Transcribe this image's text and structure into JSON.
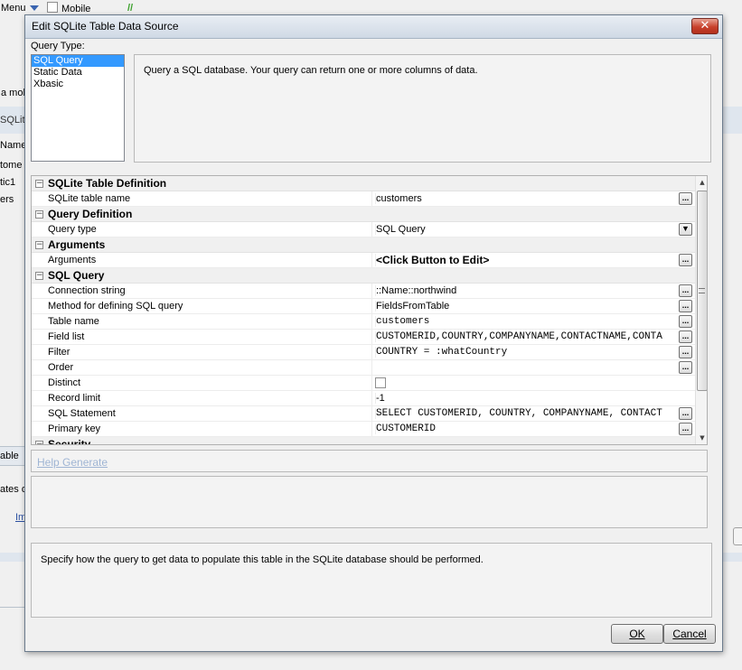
{
  "background_app": {
    "menu_label": "Menu",
    "mobile_label": "Mobile",
    "left_fragments": [
      "a mob",
      "SQLite",
      "Name",
      "tome",
      "tic1",
      "ers",
      "able",
      "ates d",
      "Im"
    ]
  },
  "dialog": {
    "title": "Edit SQLite Table Data Source",
    "close_symbol": "✕",
    "query_type": {
      "label": "Query Type:",
      "options": [
        "SQL Query",
        "Static Data",
        "Xbasic"
      ],
      "selected": "SQL Query"
    },
    "description": "Query a SQL database. Your query can return one or more columns of data.",
    "grid": {
      "rows": [
        {
          "kind": "category",
          "title": "SQLite Table Definition",
          "toggle": "−"
        },
        {
          "kind": "prop",
          "name": "SQLite table name",
          "value": "customers",
          "button": "..."
        },
        {
          "kind": "category",
          "title": "Query Definition",
          "toggle": "−"
        },
        {
          "kind": "prop",
          "name": "Query type",
          "value": "SQL Query",
          "button": "▼"
        },
        {
          "kind": "category",
          "title": "Arguments",
          "toggle": "−"
        },
        {
          "kind": "prop",
          "name": "Arguments",
          "value": "<Click Button to Edit>",
          "button": "...",
          "style": "bold"
        },
        {
          "kind": "category",
          "title": "SQL Query",
          "toggle": "−"
        },
        {
          "kind": "prop",
          "name": "Connection string",
          "value": "::Name::northwind",
          "button": "..."
        },
        {
          "kind": "prop",
          "name": "Method for defining SQL query",
          "value": "FieldsFromTable",
          "button": "..."
        },
        {
          "kind": "prop",
          "name": "Table name",
          "value": "customers",
          "button": "...",
          "style": "mono"
        },
        {
          "kind": "prop",
          "name": "Field list",
          "value": "CUSTOMERID,COUNTRY,COMPANYNAME,CONTACTNAME,CONTA",
          "button": "...",
          "style": "mono"
        },
        {
          "kind": "prop",
          "name": "Filter",
          "value": "COUNTRY = :whatCountry",
          "button": "...",
          "style": "mono"
        },
        {
          "kind": "prop",
          "name": "Order",
          "value": "",
          "button": "..."
        },
        {
          "kind": "prop",
          "name": "Distinct",
          "value": "",
          "checkbox": true
        },
        {
          "kind": "prop",
          "name": "Record limit",
          "value": "-1"
        },
        {
          "kind": "prop",
          "name": "SQL Statement",
          "value": "SELECT CUSTOMERID, COUNTRY, COMPANYNAME, CONTACT",
          "button": "...",
          "style": "mono"
        },
        {
          "kind": "prop",
          "name": "Primary key",
          "value": "CUSTOMERID",
          "button": "...",
          "style": "mono"
        },
        {
          "kind": "category",
          "title": "Security",
          "toggle": "−"
        }
      ]
    },
    "help_link": "Help Generate",
    "status_text": "Specify how the query to get data to populate this table in the SQLite database should be performed.",
    "ok_label": "OK",
    "cancel_label": "Cancel"
  }
}
